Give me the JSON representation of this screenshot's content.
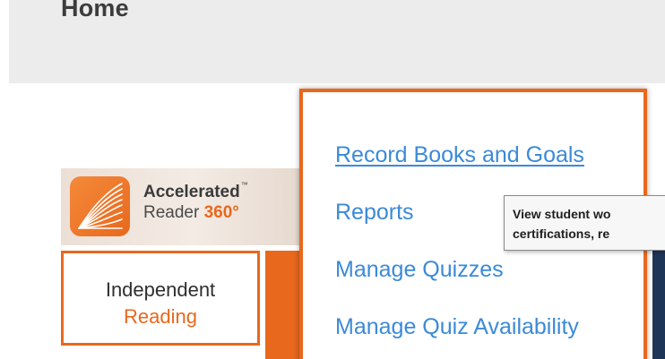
{
  "header": {
    "title": "Home"
  },
  "ar_tile": {
    "brand_line1": "Accelerated",
    "trademark": "™",
    "brand_line2_prefix": "Reader ",
    "brand_line2_number": "360°",
    "logo_icon": "book-pages-icon"
  },
  "program_box": {
    "line1": "Independent",
    "line2": "Reading"
  },
  "menu": {
    "items": [
      {
        "label": "Record Books and Goals",
        "active": true
      },
      {
        "label": "Reports",
        "active": false
      },
      {
        "label": "Manage Quizzes",
        "active": false
      },
      {
        "label": "Manage Quiz Availability",
        "active": false
      }
    ]
  },
  "tooltip": {
    "line1": "View student wo",
    "line2": "certifications, re"
  },
  "colors": {
    "accent": "#e8681d",
    "link": "#3b8ad8",
    "header_bg": "#ececec"
  }
}
